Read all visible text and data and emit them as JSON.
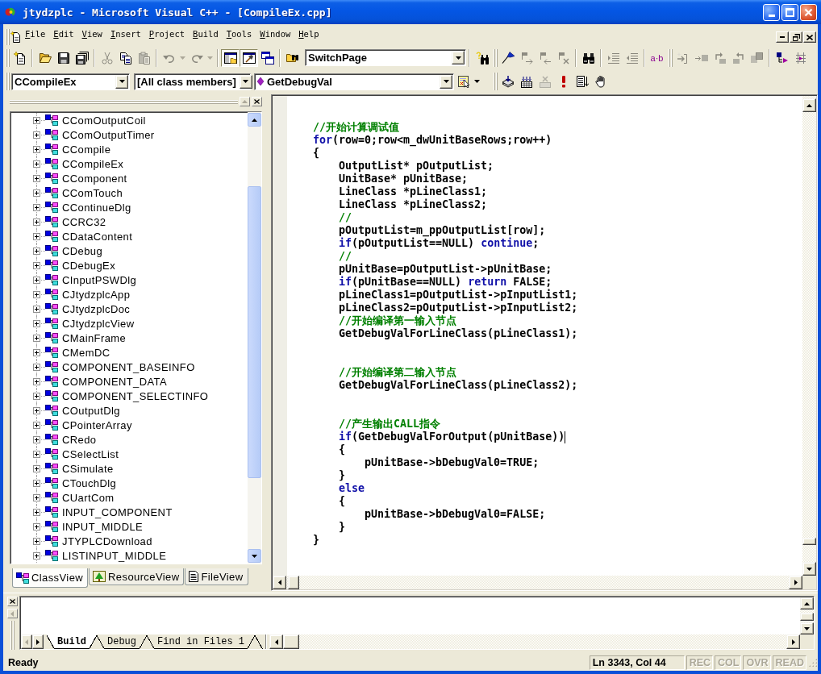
{
  "window": {
    "title": "jtydzplc - Microsoft Visual C++ - [CompileEx.cpp]"
  },
  "menu": [
    {
      "label": "File"
    },
    {
      "label": "Edit"
    },
    {
      "label": "View"
    },
    {
      "label": "Insert"
    },
    {
      "label": "Project"
    },
    {
      "label": "Build"
    },
    {
      "label": "Tools"
    },
    {
      "label": "Window"
    },
    {
      "label": "Help"
    }
  ],
  "toolbar_rows": [
    {
      "toolbars": [
        {
          "items": [
            {
              "kind": "buttons",
              "buttons": [
                {
                  "kind": "new",
                  "disabled": false,
                  "pressed": false
                }
              ]
            },
            {
              "kind": "separator"
            },
            {
              "kind": "buttons",
              "buttons": [
                {
                  "kind": "open",
                  "disabled": false,
                  "pressed": false
                },
                {
                  "kind": "save",
                  "disabled": false,
                  "pressed": false
                },
                {
                  "kind": "saveall",
                  "disabled": false,
                  "pressed": false
                }
              ]
            },
            {
              "kind": "separator"
            },
            {
              "kind": "buttons",
              "buttons": [
                {
                  "kind": "cut",
                  "disabled": true,
                  "pressed": false
                },
                {
                  "kind": "copy",
                  "disabled": false,
                  "pressed": false
                },
                {
                  "kind": "paste",
                  "disabled": true,
                  "pressed": false
                }
              ]
            },
            {
              "kind": "separator"
            },
            {
              "kind": "buttons",
              "buttons": [
                {
                  "kind": "undo",
                  "disabled": true,
                  "pressed": false
                },
                {
                  "kind": "arrow",
                  "disabled": true,
                  "pressed": false
                },
                {
                  "kind": "redo",
                  "disabled": true,
                  "pressed": false
                },
                {
                  "kind": "arrow",
                  "disabled": true,
                  "pressed": false
                }
              ]
            },
            {
              "kind": "separator"
            },
            {
              "kind": "buttons",
              "buttons": [
                {
                  "kind": "workspace",
                  "disabled": false,
                  "pressed": true
                },
                {
                  "kind": "output",
                  "disabled": false,
                  "pressed": true
                },
                {
                  "kind": "windows",
                  "disabled": false,
                  "pressed": false
                }
              ]
            },
            {
              "kind": "separator"
            },
            {
              "kind": "buttons",
              "buttons": [
                {
                  "kind": "findinfiles",
                  "disabled": false,
                  "pressed": false
                }
              ]
            },
            {
              "kind": "combo",
              "value": "SwitchPage"
            },
            {
              "kind": "separator"
            },
            {
              "kind": "buttons",
              "buttons": [
                {
                  "kind": "find",
                  "disabled": false,
                  "pressed": false
                }
              ]
            }
          ]
        },
        {
          "items": [
            {
              "kind": "buttons",
              "buttons": [
                {
                  "kind": "flag",
                  "disabled": false,
                  "pressed": false
                },
                {
                  "kind": "flagnext",
                  "disabled": true,
                  "pressed": false
                },
                {
                  "kind": "flagprev",
                  "disabled": true,
                  "pressed": false
                },
                {
                  "kind": "flagclear",
                  "disabled": true,
                  "pressed": false
                }
              ]
            },
            {
              "kind": "separator"
            },
            {
              "kind": "buttons",
              "buttons": [
                {
                  "kind": "binoculars",
                  "disabled": false,
                  "pressed": false
                }
              ]
            },
            {
              "kind": "separator"
            },
            {
              "kind": "buttons",
              "buttons": [
                {
                  "kind": "indent",
                  "disabled": true,
                  "pressed": false
                },
                {
                  "kind": "outdent",
                  "disabled": true,
                  "pressed": false
                }
              ]
            },
            {
              "kind": "separator"
            },
            {
              "kind": "buttons",
              "buttons": [
                {
                  "kind": "text",
                  "label": "a·b",
                  "disabled": false,
                  "pressed": false
                }
              ]
            }
          ]
        },
        {
          "items": [
            {
              "kind": "buttons",
              "buttons": [
                {
                  "kind": "stepinto",
                  "disabled": true,
                  "pressed": false
                },
                {
                  "kind": "stepover",
                  "disabled": true,
                  "pressed": false
                },
                {
                  "kind": "stepout",
                  "disabled": true,
                  "pressed": false
                },
                {
                  "kind": "stepback",
                  "disabled": true,
                  "pressed": false
                },
                {
                  "kind": "stack",
                  "disabled": true,
                  "pressed": false
                }
              ]
            },
            {
              "kind": "separator"
            },
            {
              "kind": "buttons",
              "buttons": [
                {
                  "kind": "branch",
                  "disabled": false,
                  "pressed": false
                },
                {
                  "kind": "ladder",
                  "disabled": false,
                  "pressed": false
                }
              ]
            }
          ]
        }
      ]
    },
    {
      "toolbars": [
        {
          "items": [
            {
              "kind": "combo",
              "value": "CCompileEx"
            },
            {
              "kind": "combo",
              "value": "[All class members]"
            },
            {
              "kind": "membercombo",
              "value": "GetDebugVal"
            },
            {
              "kind": "buttons",
              "buttons": [
                {
                  "kind": "wizard",
                  "disabled": false,
                  "pressed": false
                },
                {
                  "kind": "arrow",
                  "disabled": false,
                  "pressed": false
                }
              ]
            }
          ]
        },
        {
          "items": [
            {
              "kind": "buttons",
              "buttons": [
                {
                  "kind": "compile",
                  "disabled": false,
                  "pressed": false
                },
                {
                  "kind": "build",
                  "disabled": false,
                  "pressed": false
                },
                {
                  "kind": "stopbuild",
                  "disabled": true,
                  "pressed": false
                },
                {
                  "kind": "execute",
                  "disabled": false,
                  "pressed": false
                },
                {
                  "kind": "go",
                  "disabled": false,
                  "pressed": false
                },
                {
                  "kind": "hand",
                  "disabled": false,
                  "pressed": false
                }
              ]
            }
          ]
        }
      ]
    }
  ],
  "workspace": {
    "classes": [
      {
        "label": "CComOutputCoil",
        "expanded": false
      },
      {
        "label": "CComOutputTimer",
        "expanded": false
      },
      {
        "label": "CCompile",
        "expanded": false
      },
      {
        "label": "CCompileEx",
        "expanded": false
      },
      {
        "label": "CComponent",
        "expanded": false
      },
      {
        "label": "CComTouch",
        "expanded": false
      },
      {
        "label": "CContinueDlg",
        "expanded": false
      },
      {
        "label": "CCRC32",
        "expanded": false
      },
      {
        "label": "CDataContent",
        "expanded": false
      },
      {
        "label": "CDebug",
        "expanded": false
      },
      {
        "label": "CDebugEx",
        "expanded": false
      },
      {
        "label": "CInputPSWDlg",
        "expanded": false
      },
      {
        "label": "CJtydzplcApp",
        "expanded": false
      },
      {
        "label": "CJtydzplcDoc",
        "expanded": false
      },
      {
        "label": "CJtydzplcView",
        "expanded": false
      },
      {
        "label": "CMainFrame",
        "expanded": false
      },
      {
        "label": "CMemDC",
        "expanded": false
      },
      {
        "label": "COMPONENT_BASEINFO",
        "expanded": false
      },
      {
        "label": "COMPONENT_DATA",
        "expanded": false
      },
      {
        "label": "COMPONENT_SELECTINFO",
        "expanded": false
      },
      {
        "label": "COutputDlg",
        "expanded": false
      },
      {
        "label": "CPointerArray",
        "expanded": false
      },
      {
        "label": "CRedo",
        "expanded": false
      },
      {
        "label": "CSelectList",
        "expanded": false
      },
      {
        "label": "CSimulate",
        "expanded": false
      },
      {
        "label": "CTouchDlg",
        "expanded": false
      },
      {
        "label": "CUartCom",
        "expanded": false
      },
      {
        "label": "INPUT_COMPONENT",
        "expanded": false
      },
      {
        "label": "INPUT_MIDDLE",
        "expanded": false
      },
      {
        "label": "JTYPLCDownload",
        "expanded": false
      },
      {
        "label": "LISTINPUT_MIDDLE",
        "expanded": false
      }
    ],
    "tabs": [
      {
        "kind": "classes",
        "label": "ClassView",
        "selected": true
      },
      {
        "kind": "resources",
        "label": "ResourceView",
        "selected": false
      },
      {
        "kind": "files",
        "label": "FileView",
        "selected": false
      }
    ]
  },
  "editor": {
    "lines": [
      {
        "kind": "code",
        "tokens": [
          {
            "kind": "comment",
            "text": "//开始计算调试值"
          }
        ]
      },
      {
        "kind": "code",
        "tokens": [
          {
            "kind": "keyword",
            "text": "for"
          },
          {
            "kind": "plain",
            "text": "(row=0;row<m_dwUnitBaseRows;row++)"
          }
        ]
      },
      {
        "kind": "code",
        "tokens": [
          {
            "kind": "plain",
            "text": "{"
          }
        ],
        "children": [
          {
            "kind": "code",
            "tokens": [
              {
                "kind": "plain",
                "text": "OutputList* pOutputList;"
              }
            ]
          },
          {
            "kind": "code",
            "tokens": [
              {
                "kind": "plain",
                "text": "UnitBase* pUnitBase;"
              }
            ]
          },
          {
            "kind": "code",
            "tokens": [
              {
                "kind": "plain",
                "text": "LineClass *pLineClass1;"
              }
            ]
          },
          {
            "kind": "code",
            "tokens": [
              {
                "kind": "plain",
                "text": "LineClass *pLineClass2;"
              }
            ]
          },
          {
            "kind": "code",
            "tokens": [
              {
                "kind": "comment",
                "text": "//"
              }
            ]
          },
          {
            "kind": "code",
            "tokens": [
              {
                "kind": "plain",
                "text": "pOutputList=m_ppOutputList[row];"
              }
            ]
          },
          {
            "kind": "code",
            "tokens": [
              {
                "kind": "keyword",
                "text": "if"
              },
              {
                "kind": "plain",
                "text": "(pOutputList==NULL) "
              },
              {
                "kind": "keyword",
                "text": "continue"
              },
              {
                "kind": "plain",
                "text": ";"
              }
            ]
          },
          {
            "kind": "code",
            "tokens": [
              {
                "kind": "comment",
                "text": "//"
              }
            ]
          },
          {
            "kind": "code",
            "tokens": [
              {
                "kind": "plain",
                "text": "pUnitBase=pOutputList->pUnitBase;"
              }
            ]
          },
          {
            "kind": "code",
            "tokens": [
              {
                "kind": "keyword",
                "text": "if"
              },
              {
                "kind": "plain",
                "text": "(pUnitBase==NULL) "
              },
              {
                "kind": "keyword",
                "text": "return"
              },
              {
                "kind": "plain",
                "text": " FALSE;"
              }
            ]
          },
          {
            "kind": "code",
            "tokens": [
              {
                "kind": "plain",
                "text": "pLineClass1=pOutputList->pInputList1;"
              }
            ]
          },
          {
            "kind": "code",
            "tokens": [
              {
                "kind": "plain",
                "text": "pLineClass2=pOutputList->pInputList2;"
              }
            ]
          },
          {
            "kind": "code",
            "tokens": [
              {
                "kind": "comment",
                "text": "//开始编译第一输入节点"
              }
            ]
          },
          {
            "kind": "code",
            "tokens": [
              {
                "kind": "plain",
                "text": "GetDebugValForLineClass(pLineClass1);"
              }
            ]
          },
          {
            "kind": "blank"
          },
          {
            "kind": "blank"
          },
          {
            "kind": "code",
            "tokens": [
              {
                "kind": "comment",
                "text": "//开始编译第二输入节点"
              }
            ]
          },
          {
            "kind": "code",
            "tokens": [
              {
                "kind": "plain",
                "text": "GetDebugValForLineClass(pLineClass2);"
              }
            ]
          },
          {
            "kind": "blank"
          },
          {
            "kind": "blank"
          },
          {
            "kind": "code",
            "tokens": [
              {
                "kind": "comment",
                "text": "//产生输出CALL指令"
              }
            ]
          },
          {
            "kind": "code",
            "tokens": [
              {
                "kind": "keyword",
                "text": "if"
              },
              {
                "kind": "plain",
                "text": "(GetDebugValForOutput(pUnitBase))"
              },
              {
                "kind": "cursor"
              }
            ]
          },
          {
            "kind": "code",
            "tokens": [
              {
                "kind": "plain",
                "text": "{"
              }
            ],
            "children": [
              {
                "kind": "code",
                "tokens": [
                  {
                    "kind": "plain",
                    "text": "pUnitBase->bDebugVal0=TRUE;"
                  }
                ]
              }
            ]
          },
          {
            "kind": "code",
            "tokens": [
              {
                "kind": "plain",
                "text": "}"
              }
            ]
          },
          {
            "kind": "code",
            "tokens": [
              {
                "kind": "keyword",
                "text": "else"
              }
            ]
          },
          {
            "kind": "code",
            "tokens": [
              {
                "kind": "plain",
                "text": "{"
              }
            ],
            "children": [
              {
                "kind": "code",
                "tokens": [
                  {
                    "kind": "plain",
                    "text": "pUnitBase->bDebugVal0=FALSE;"
                  }
                ]
              }
            ]
          },
          {
            "kind": "code",
            "tokens": [
              {
                "kind": "plain",
                "text": "}"
              }
            ]
          }
        ]
      },
      {
        "kind": "code",
        "tokens": [
          {
            "kind": "plain",
            "text": "}"
          }
        ]
      }
    ]
  },
  "output": {
    "scroll_buttons": [
      {
        "kind": "left",
        "disabled": true
      },
      {
        "kind": "right",
        "disabled": false
      }
    ],
    "tabs": [
      {
        "label": "Build",
        "selected": true
      },
      {
        "label": "Debug",
        "selected": false
      },
      {
        "label": "Find in Files 1",
        "selected": false
      }
    ]
  },
  "status_bar": {
    "message": "Ready",
    "position": "Ln 3343, Col 44",
    "indicators": [
      {
        "label": "REC",
        "on": false
      },
      {
        "label": "COL",
        "on": false
      },
      {
        "label": "OVR",
        "on": false
      },
      {
        "label": "READ",
        "on": false
      }
    ]
  }
}
